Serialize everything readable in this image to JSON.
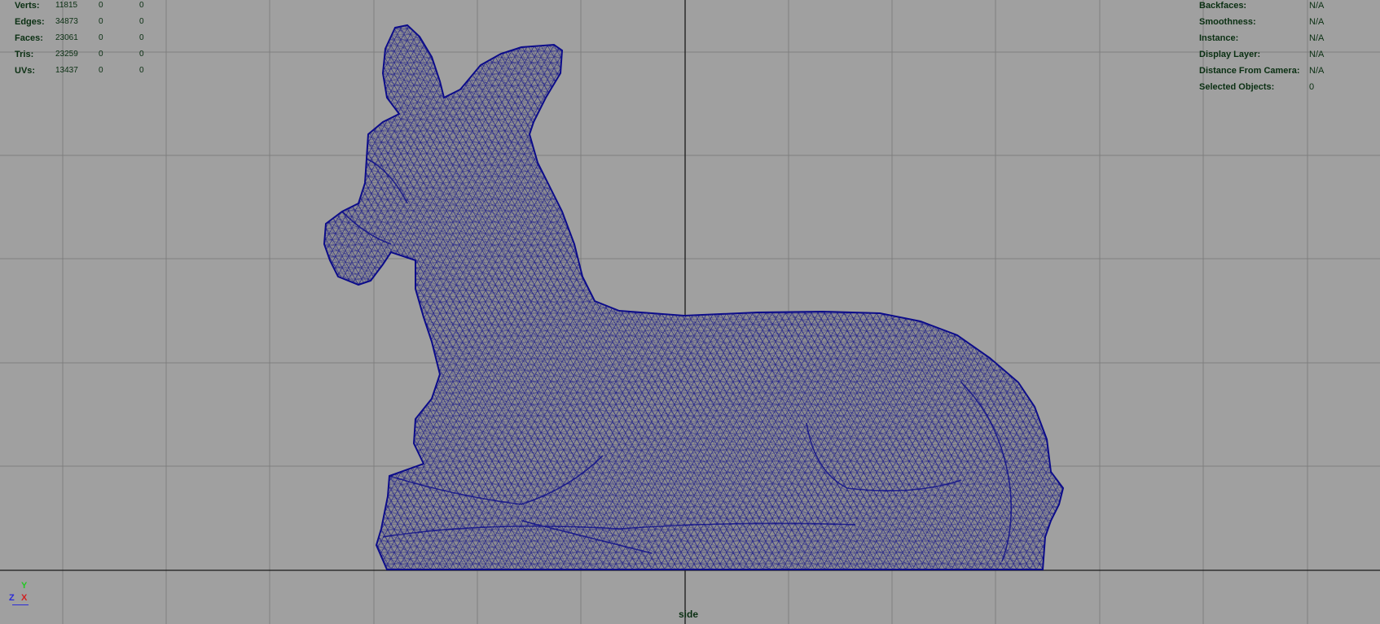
{
  "stats_left": [
    {
      "label": "Verts:",
      "v1": "11815",
      "v2": "0",
      "v3": "0"
    },
    {
      "label": "Edges:",
      "v1": "34873",
      "v2": "0",
      "v3": "0"
    },
    {
      "label": "Faces:",
      "v1": "23061",
      "v2": "0",
      "v3": "0"
    },
    {
      "label": "Tris:",
      "v1": "23259",
      "v2": "0",
      "v3": "0"
    },
    {
      "label": "UVs:",
      "v1": "13437",
      "v2": "0",
      "v3": "0"
    }
  ],
  "stats_right": [
    {
      "label": "Backfaces:",
      "value": "N/A"
    },
    {
      "label": "Smoothness:",
      "value": "N/A"
    },
    {
      "label": "Instance:",
      "value": "N/A"
    },
    {
      "label": "Display Layer:",
      "value": "N/A"
    },
    {
      "label": "Distance From Camera:",
      "value": "N/A"
    },
    {
      "label": "Selected Objects:",
      "value": "0"
    }
  ],
  "camera_name": "side",
  "axis": {
    "y": "Y",
    "z": "Z",
    "x": "X"
  },
  "colors": {
    "viewport_bg": "#a0a0a0",
    "grid_line": "#7f7f7f",
    "axis_line": "#1a1a1a",
    "wire": "#0c0c8a",
    "mesh_fill": "#8b8b90",
    "hud_text": "#0a2f12"
  }
}
